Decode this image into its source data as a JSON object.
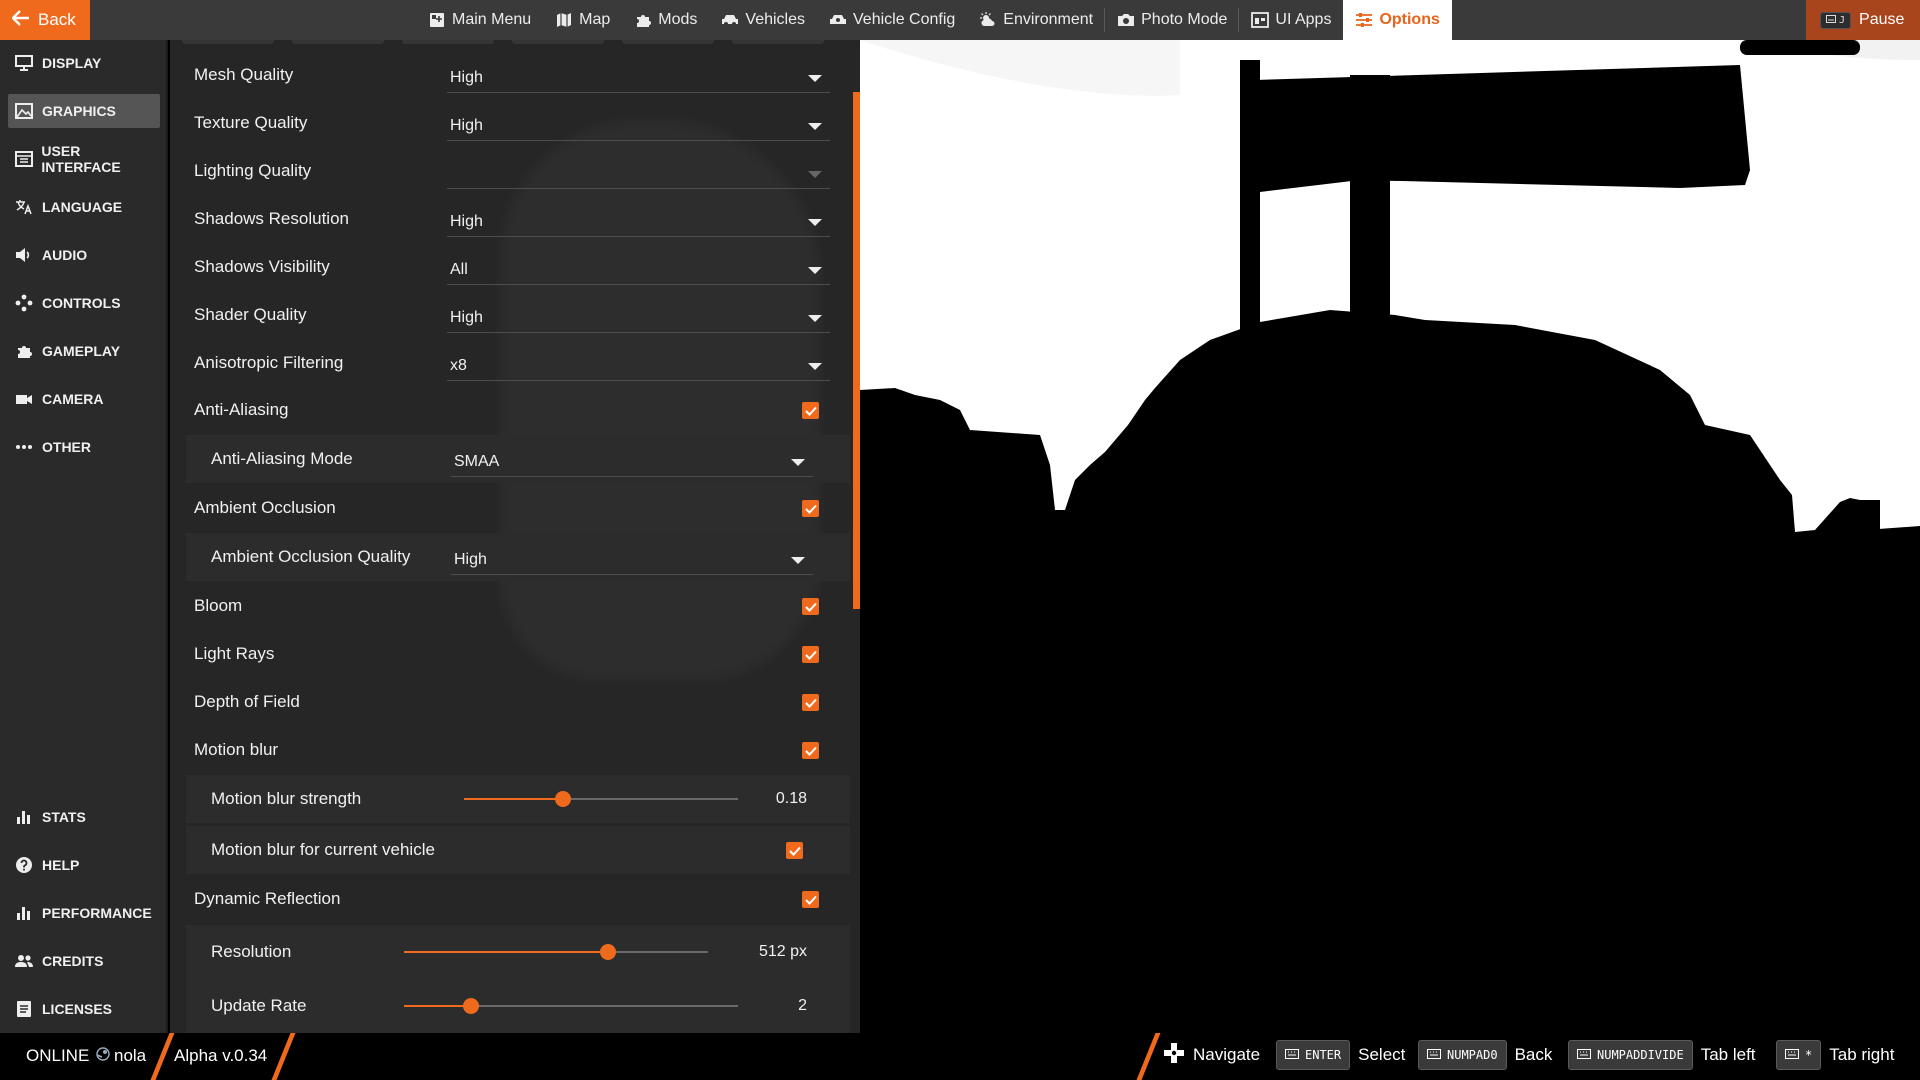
{
  "topbar": {
    "back_label": "Back",
    "menu": [
      {
        "label": "Main Menu",
        "icon": "main-menu-icon"
      },
      {
        "label": "Map",
        "icon": "map-icon"
      },
      {
        "label": "Mods",
        "icon": "puzzle-icon"
      },
      {
        "label": "Vehicles",
        "icon": "car-icon"
      },
      {
        "label": "Vehicle Config",
        "icon": "vehicle-config-icon"
      },
      {
        "label": "Environment",
        "icon": "weather-icon"
      },
      {
        "label": "Photo Mode",
        "icon": "camera-icon"
      },
      {
        "label": "UI Apps",
        "icon": "ui-apps-icon"
      },
      {
        "label": "Options",
        "icon": "sliders-icon",
        "active": true
      }
    ],
    "pause_key": "J",
    "pause_label": "Pause"
  },
  "sidebar": {
    "items": [
      {
        "label": "DISPLAY",
        "icon": "monitor-icon"
      },
      {
        "label": "GRAPHICS",
        "icon": "image-icon",
        "active": true
      },
      {
        "label": "USER INTERFACE",
        "icon": "window-icon"
      },
      {
        "label": "LANGUAGE",
        "icon": "translate-icon"
      },
      {
        "label": "AUDIO",
        "icon": "speaker-icon"
      },
      {
        "label": "CONTROLS",
        "icon": "gamepad-icon"
      },
      {
        "label": "GAMEPLAY",
        "icon": "puzzle-icon"
      },
      {
        "label": "CAMERA",
        "icon": "video-camera-icon"
      },
      {
        "label": "OTHER",
        "icon": "more-icon"
      }
    ],
    "bottom_items": [
      {
        "label": "STATS",
        "icon": "bar-chart-icon"
      },
      {
        "label": "HELP",
        "icon": "help-icon"
      },
      {
        "label": "PERFORMANCE",
        "icon": "bar-chart-icon"
      },
      {
        "label": "CREDITS",
        "icon": "people-icon"
      },
      {
        "label": "LICENSES",
        "icon": "document-icon"
      }
    ]
  },
  "settings": {
    "mesh_quality": {
      "label": "Mesh Quality",
      "value": "High"
    },
    "texture_quality": {
      "label": "Texture Quality",
      "value": "High"
    },
    "lighting_quality": {
      "label": "Lighting Quality",
      "value": ""
    },
    "shadows_resolution": {
      "label": "Shadows Resolution",
      "value": "High"
    },
    "shadows_visibility": {
      "label": "Shadows Visibility",
      "value": "All"
    },
    "shader_quality": {
      "label": "Shader Quality",
      "value": "High"
    },
    "anisotropic_filtering": {
      "label": "Anisotropic Filtering",
      "value": "x8"
    },
    "anti_aliasing": {
      "label": "Anti-Aliasing",
      "checked": true
    },
    "anti_aliasing_mode": {
      "label": "Anti-Aliasing Mode",
      "value": "SMAA"
    },
    "ambient_occlusion": {
      "label": "Ambient Occlusion",
      "checked": true
    },
    "ambient_occlusion_quality": {
      "label": "Ambient Occlusion Quality",
      "value": "High"
    },
    "bloom": {
      "label": "Bloom",
      "checked": true
    },
    "light_rays": {
      "label": "Light Rays",
      "checked": true
    },
    "depth_of_field": {
      "label": "Depth of Field",
      "checked": true
    },
    "motion_blur": {
      "label": "Motion blur",
      "checked": true
    },
    "motion_blur_strength": {
      "label": "Motion blur strength",
      "value": "0.18",
      "fraction": 0.36
    },
    "motion_blur_current_vehicle": {
      "label": "Motion blur for current vehicle",
      "checked": true
    },
    "dynamic_reflection": {
      "label": "Dynamic Reflection",
      "checked": true
    },
    "resolution": {
      "label": "Resolution",
      "value": "512 px",
      "fraction": 0.67
    },
    "update_rate": {
      "label": "Update Rate",
      "value": "2",
      "fraction": 0.2
    }
  },
  "bottombar": {
    "status": "ONLINE",
    "username": "nola",
    "version": "Alpha v.0.34",
    "hints": [
      {
        "key": "",
        "label": "Navigate",
        "icon": "dpad-icon"
      },
      {
        "key": "ENTER",
        "label": "Select"
      },
      {
        "key": "NUMPAD0",
        "label": "Back"
      },
      {
        "key": "NUMPADDIVIDE",
        "label": "Tab left"
      },
      {
        "key": "*",
        "label": "Tab right"
      }
    ]
  },
  "colors": {
    "accent": "#f06a1e",
    "panel": "#262626",
    "sidebar": "#2a2a2a",
    "topbar": "#3a3a3a"
  }
}
